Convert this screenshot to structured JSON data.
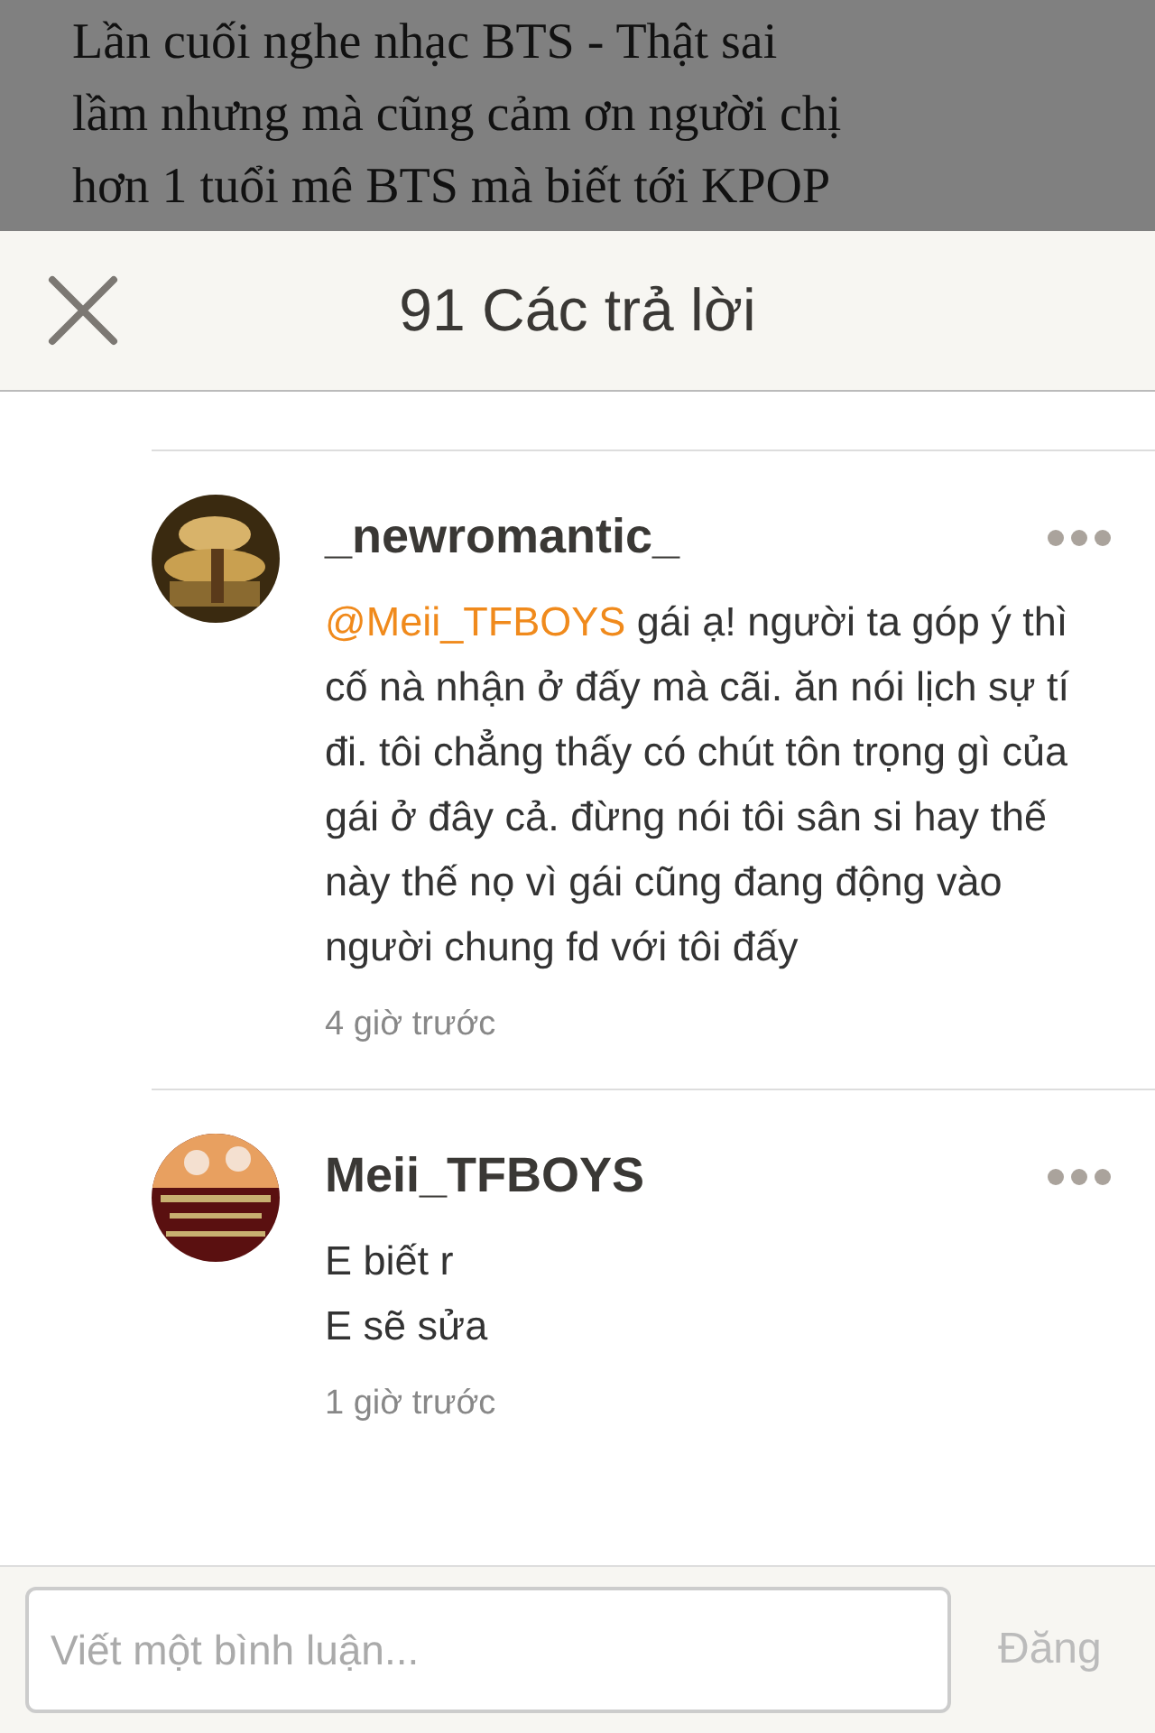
{
  "background_article": {
    "title_lines": [
      "Lần cuối nghe nhạc BTS - Thật sai",
      "lầm nhưng mà cũng cảm ơn người chị",
      "hơn 1 tuổi mê BTS mà biết tới KPOP"
    ]
  },
  "header": {
    "title": "91 Các trả lời"
  },
  "comments": [
    {
      "username": "_newromantic_",
      "mention": "@Meii_TFBOYS",
      "text": "gái ạ! người ta góp ý thì cố nà nhận ở đấy mà cãi. ăn nói lịch sự tí đi. tôi chẳng thấy có chút tôn trọng gì của gái ở đây cả. đừng nói tôi sân si hay thế này thế nọ vì gái cũng đang động vào người chung fd với tôi đấy",
      "time": "4 giờ trước"
    },
    {
      "username": "Meii_TFBOYS",
      "text": "E biết r\nE sẽ sửa",
      "time": "1 giờ trước"
    }
  ],
  "composer": {
    "placeholder": "Viết một bình luận...",
    "button": "Đăng"
  }
}
